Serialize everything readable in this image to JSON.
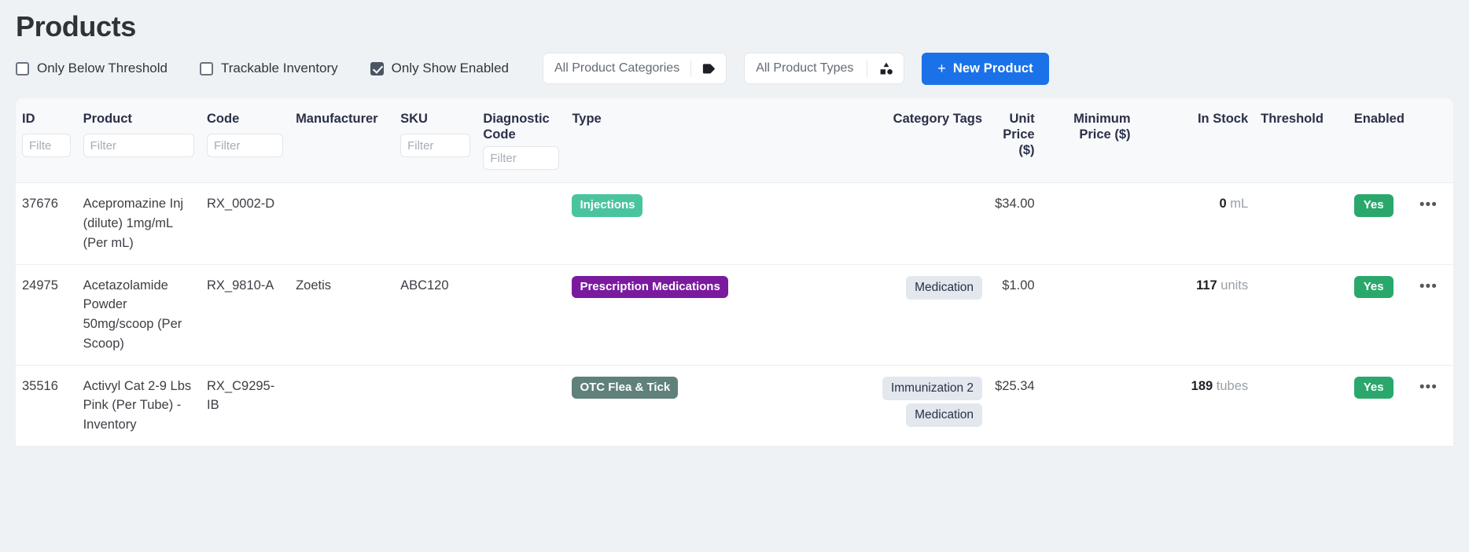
{
  "page": {
    "title": "Products"
  },
  "toolbar": {
    "checkboxes": [
      {
        "label": "Only Below Threshold",
        "checked": false
      },
      {
        "label": "Trackable Inventory",
        "checked": false
      },
      {
        "label": "Only Show Enabled",
        "checked": true
      }
    ],
    "selects": [
      {
        "label": "All Product Categories",
        "icon": "tag-icon"
      },
      {
        "label": "All Product Types",
        "icon": "shapes-icon"
      }
    ],
    "new_button": {
      "label": "New Product",
      "plus": "+",
      "color": "#1b72e8"
    }
  },
  "table": {
    "columns": [
      {
        "header": "ID",
        "filter_placeholder": "Filte",
        "has_filter": true,
        "align": "left"
      },
      {
        "header": "Product",
        "filter_placeholder": "Filter",
        "has_filter": true,
        "align": "left"
      },
      {
        "header": "Code",
        "filter_placeholder": "Filter",
        "has_filter": true,
        "align": "left"
      },
      {
        "header": "Manufacturer",
        "filter_placeholder": "",
        "has_filter": false,
        "align": "left"
      },
      {
        "header": "SKU",
        "filter_placeholder": "Filter",
        "has_filter": true,
        "align": "left"
      },
      {
        "header": "Diagnostic Code",
        "filter_placeholder": "Filter",
        "has_filter": true,
        "align": "left"
      },
      {
        "header": "Type",
        "filter_placeholder": "",
        "has_filter": false,
        "align": "left"
      },
      {
        "header": "Category Tags",
        "filter_placeholder": "",
        "has_filter": false,
        "align": "right"
      },
      {
        "header": "Unit Price ($)",
        "filter_placeholder": "",
        "has_filter": false,
        "align": "right"
      },
      {
        "header": "Minimum Price ($)",
        "filter_placeholder": "",
        "has_filter": false,
        "align": "right"
      },
      {
        "header": "In Stock",
        "filter_placeholder": "",
        "has_filter": false,
        "align": "right"
      },
      {
        "header": "Threshold",
        "filter_placeholder": "",
        "has_filter": false,
        "align": "left"
      },
      {
        "header": "Enabled",
        "filter_placeholder": "",
        "has_filter": false,
        "align": "left"
      }
    ],
    "rows": [
      {
        "id": "37676",
        "product": "Acepromazine Inj (dilute) 1mg/mL (Per mL)",
        "code": "RX_0002-D",
        "manufacturer": "",
        "sku": "",
        "diagnostic_code": "",
        "type": {
          "label": "Injections",
          "style": "injections"
        },
        "category_tags": [],
        "unit_price": "$34.00",
        "minimum_price": "",
        "stock_value": "0",
        "stock_unit": "mL",
        "threshold": "",
        "enabled": "Yes",
        "actions": "•••"
      },
      {
        "id": "24975",
        "product": "Acetazolamide Powder 50mg/scoop (Per Scoop)",
        "code": "RX_9810-A",
        "manufacturer": "Zoetis",
        "sku": "ABC120",
        "diagnostic_code": "",
        "type": {
          "label": "Prescription Medications",
          "style": "prescription"
        },
        "category_tags": [
          "Medication"
        ],
        "unit_price": "$1.00",
        "minimum_price": "",
        "stock_value": "117",
        "stock_unit": "units",
        "threshold": "",
        "enabled": "Yes",
        "actions": "•••"
      },
      {
        "id": "35516",
        "product": "Activyl Cat 2-9 Lbs Pink (Per Tube) - Inventory",
        "code": "RX_C9295-IB",
        "manufacturer": "",
        "sku": "",
        "diagnostic_code": "",
        "type": {
          "label": "OTC Flea & Tick",
          "style": "otc"
        },
        "category_tags": [
          "Immunization 2",
          "Medication"
        ],
        "unit_price": "$25.34",
        "minimum_price": "",
        "stock_value": "189",
        "stock_unit": "tubes",
        "threshold": "",
        "enabled": "Yes",
        "actions": "•••"
      }
    ]
  },
  "colors": {
    "accent": "#1b72e8",
    "badge_injections": "#4ac49f",
    "badge_prescription": "#7a1a9e",
    "badge_otc": "#60807c",
    "badge_enabled": "#2aa86c",
    "chip_bg": "#e3e7ee",
    "page_bg": "#eef2f5"
  }
}
